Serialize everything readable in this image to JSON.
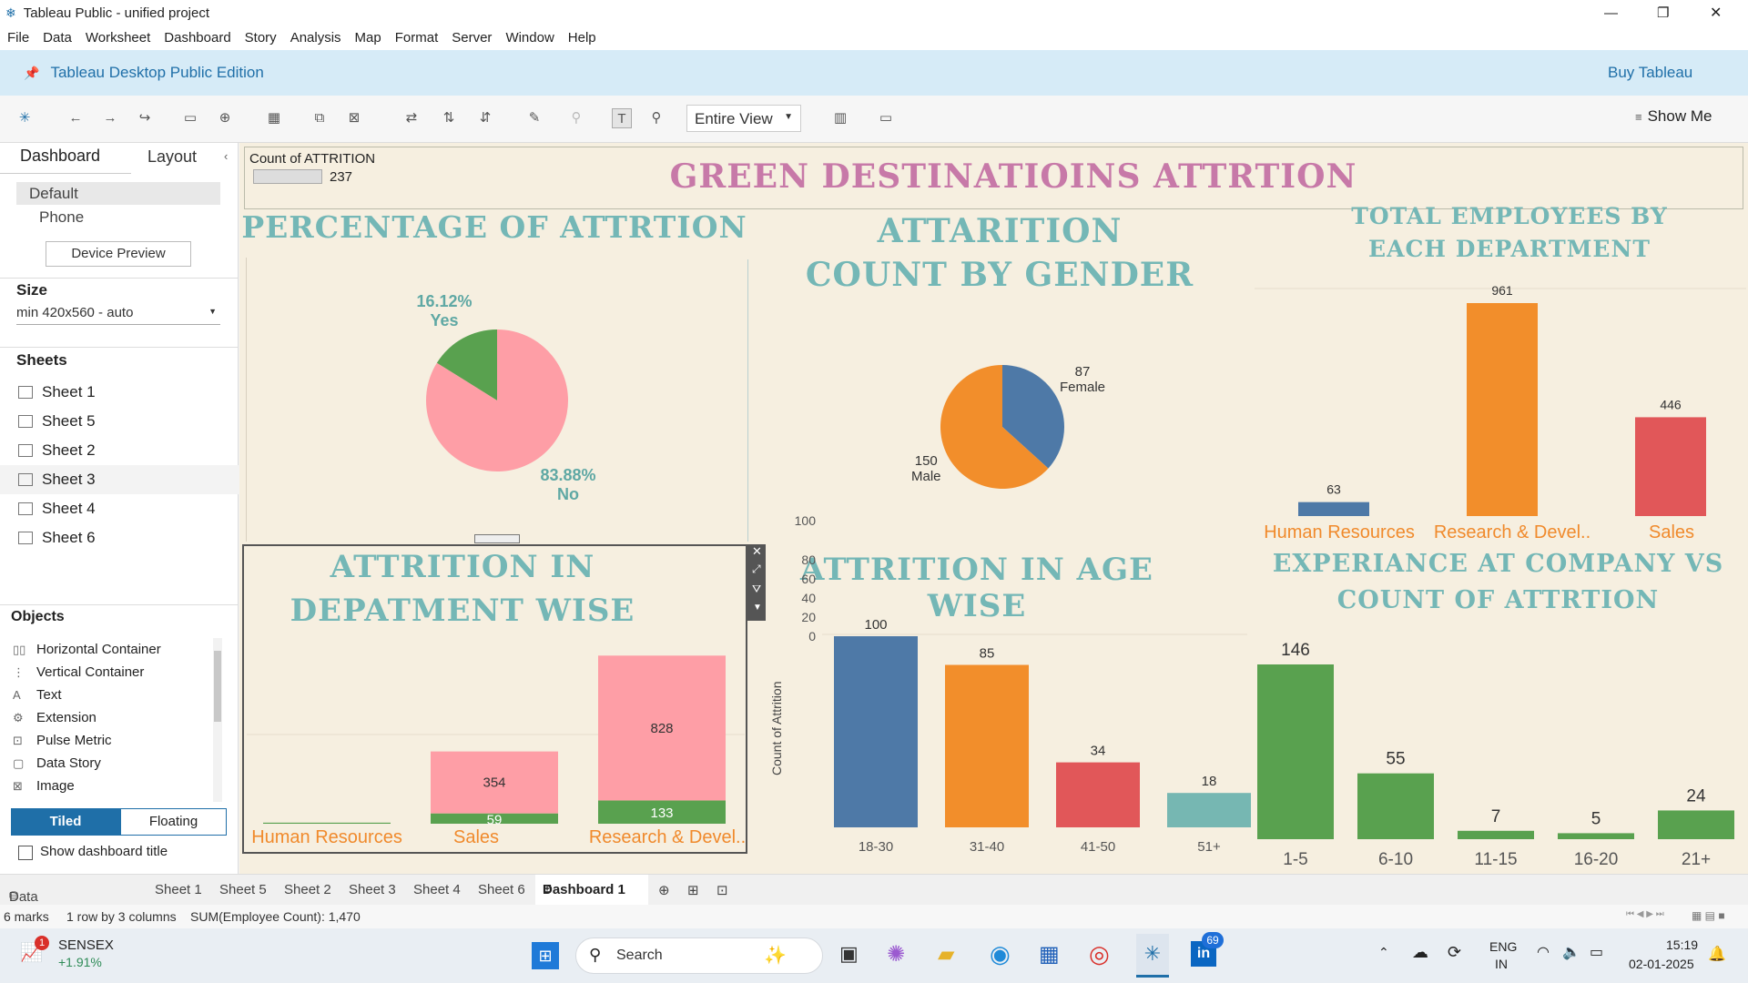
{
  "window": {
    "title": "Tableau Public - unified project",
    "min": "—",
    "max": "❐",
    "close": "✕"
  },
  "menu": [
    "File",
    "Data",
    "Worksheet",
    "Dashboard",
    "Story",
    "Analysis",
    "Map",
    "Format",
    "Server",
    "Window",
    "Help"
  ],
  "banner": {
    "edition": "Tableau Desktop Public Edition",
    "buy": "Buy Tableau"
  },
  "toolbar": {
    "view": "Entire View",
    "show_me": "Show Me"
  },
  "left": {
    "tab_dashboard": "Dashboard",
    "tab_layout": "Layout",
    "devices": [
      "Default",
      "Phone"
    ],
    "device_preview": "Device Preview",
    "size_heading": "Size",
    "size_value": "min 420x560 - auto",
    "sheets_heading": "Sheets",
    "sheets": [
      "Sheet 1",
      "Sheet 5",
      "Sheet 2",
      "Sheet 3",
      "Sheet 4",
      "Sheet 6"
    ],
    "objects_heading": "Objects",
    "objects": [
      "Horizontal Container",
      "Vertical Container",
      "Text",
      "Extension",
      "Pulse Metric",
      "Data Story",
      "Image"
    ],
    "tiled": "Tiled",
    "floating": "Floating",
    "show_title": "Show dashboard title"
  },
  "dashboard": {
    "main_title": "GREEN DESTINATIOINS ATTRTION",
    "count_label": "Count of ATTRITION",
    "count_value": "237",
    "titles": {
      "pct": "PERCENTAGE OF ATTRTION",
      "gender": "ATTARITION COUNT BY GENDER",
      "dept_total": "TOTAL EMPLOYEES BY EACH DEPARTMENT",
      "dept_attr": "ATTRITION IN DEPATMENT WISE",
      "age": "ATTRITION IN AGE WISE",
      "exp": "EXPERIANCE AT COMPANY VS  COUNT OF ATTRTION"
    },
    "age_axis_title": "Count of Attrition",
    "colors": {
      "pink": "#fe9ea6",
      "green": "#59a14f",
      "blue": "#4e79a7",
      "orange": "#f28e2b",
      "red": "#e15759",
      "teal": "#76b7b2"
    }
  },
  "chart_data": [
    {
      "type": "pie",
      "title": "PERCENTAGE OF ATTRTION",
      "slices": [
        {
          "label": "Yes",
          "value": 16.12,
          "text": "16.12%"
        },
        {
          "label": "No",
          "value": 83.88,
          "text": "83.88%"
        }
      ]
    },
    {
      "type": "pie",
      "title": "ATTARITION COUNT BY GENDER",
      "slices": [
        {
          "label": "Female",
          "value": 87
        },
        {
          "label": "Male",
          "value": 150
        }
      ]
    },
    {
      "type": "bar",
      "title": "TOTAL EMPLOYEES BY EACH DEPARTMENT",
      "categories": [
        "Human Resources",
        "Research & Devel..",
        "Sales"
      ],
      "values": [
        63,
        961,
        446
      ]
    },
    {
      "type": "bar",
      "title": "ATTRITION IN DEPATMENT WISE",
      "categories": [
        "Human Resources",
        "Sales",
        "Research & Devel.."
      ],
      "series": [
        {
          "values": [
            6,
            59,
            133
          ]
        },
        {
          "values": [
            0,
            354,
            828
          ]
        }
      ]
    },
    {
      "type": "bar",
      "title": "ATTRITION IN AGE WISE",
      "categories": [
        "18-30",
        "31-40",
        "41-50",
        "51+"
      ],
      "values": [
        100,
        85,
        34,
        18
      ],
      "ylabel": "Count of Attrition",
      "ylim": [
        0,
        100
      ],
      "yticks": [
        "0",
        "20",
        "40",
        "60",
        "80",
        "100"
      ]
    },
    {
      "type": "bar",
      "title": "EXPERIANCE AT COMPANY VS  COUNT OF ATTRTION",
      "categories": [
        "1-5",
        "6-10",
        "11-15",
        "16-20",
        "21+"
      ],
      "values": [
        146,
        55,
        7,
        5,
        24
      ]
    }
  ],
  "tabs": [
    "Data Source",
    "Sheet 1",
    "Sheet 5",
    "Sheet 2",
    "Sheet 3",
    "Sheet 4",
    "Sheet 6",
    "Dashboard 1"
  ],
  "status": {
    "marks": "6 marks",
    "rows": "1 row by 3 columns",
    "sum": "SUM(Employee Count): 1,470"
  },
  "taskbar": {
    "stock_name": "SENSEX",
    "stock_change": "+1.91%",
    "stock_badge": "1",
    "search": "Search",
    "lang1": "ENG",
    "lang2": "IN",
    "time": "15:19",
    "date": "02-01-2025",
    "linkedin_badge": "69"
  }
}
